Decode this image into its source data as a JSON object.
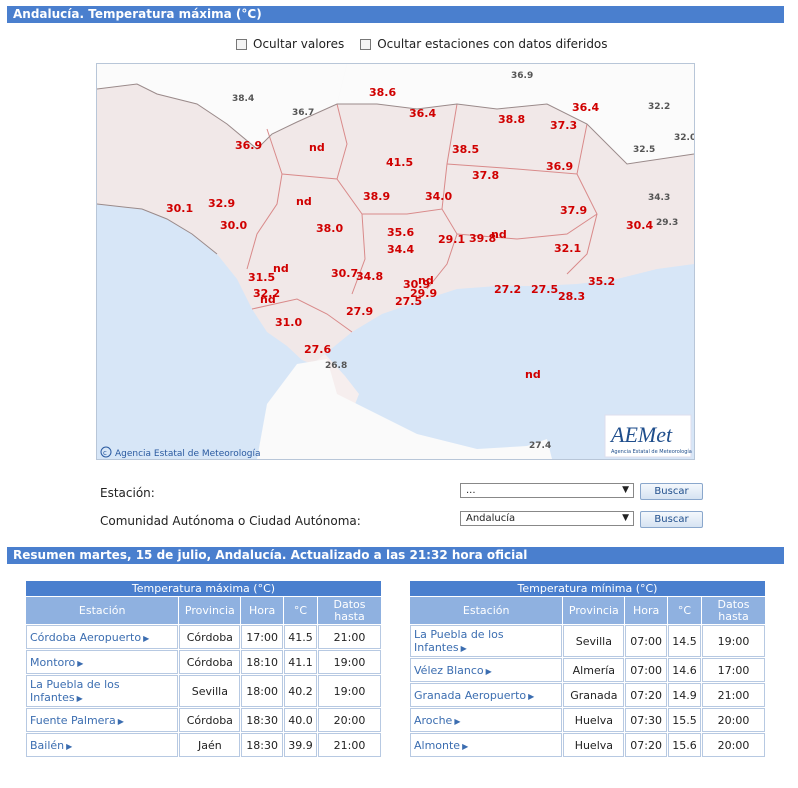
{
  "header": {
    "title": "Andalucía. Temperatura máxima (°C)"
  },
  "options": {
    "hide_values": "Ocultar valores",
    "hide_deferred": "Ocultar estaciones con datos diferidos"
  },
  "map": {
    "copyright": "Agencia Estatal de Meteorología",
    "logo_text": "AEMet",
    "logo_subtext": "Agencia Estatal de Meteorología",
    "values": [
      "38.6",
      "36.4",
      "36.4",
      "38.8",
      "37.3",
      "36.9",
      "nd",
      "41.5",
      "38.5",
      "37.8",
      "36.9",
      "32.9",
      "30.1",
      "nd",
      "38.9",
      "34.0",
      "37.9",
      "30.0",
      "38.0",
      "35.6",
      "nd",
      "29.1",
      "39.8",
      "30.4",
      "34.4",
      "32.1",
      "nd",
      "31.5",
      "30.7",
      "34.8",
      "30.9",
      "nd",
      "35.2",
      "32.2",
      "nd",
      "29.9",
      "27.5",
      "27.2",
      "27.5",
      "28.3",
      "27.9",
      "31.0",
      "27.6",
      "nd"
    ],
    "neighbors": [
      "36.9",
      "38.4",
      "36.7",
      "32.2",
      "32.0",
      "32.5",
      "34.3",
      "29.3",
      "26.8",
      "27.4"
    ]
  },
  "form": {
    "station_label": "Estación:",
    "station_value": "...",
    "community_label": "Comunidad Autónoma o Ciudad Autónoma:",
    "community_value": "Andalucía",
    "search_button": "Buscar"
  },
  "summary": {
    "title": "Resumen martes, 15 de julio, Andalucía. Actualizado a las 21:32 hora oficial"
  },
  "max_table": {
    "caption": "Temperatura máxima (°C)",
    "headers": {
      "station": "Estación",
      "province": "Provincia",
      "hour": "Hora",
      "degrees": "°C",
      "until": "Datos hasta"
    },
    "rows": [
      {
        "station": "Córdoba Aeropuerto",
        "province": "Córdoba",
        "hour": "17:00",
        "value": "41.5",
        "until": "21:00"
      },
      {
        "station": "Montoro",
        "province": "Córdoba",
        "hour": "18:10",
        "value": "41.1",
        "until": "19:00"
      },
      {
        "station": "La Puebla de los Infantes",
        "province": "Sevilla",
        "hour": "18:00",
        "value": "40.2",
        "until": "19:00"
      },
      {
        "station": "Fuente Palmera",
        "province": "Córdoba",
        "hour": "18:30",
        "value": "40.0",
        "until": "20:00"
      },
      {
        "station": "Bailén",
        "province": "Jaén",
        "hour": "18:30",
        "value": "39.9",
        "until": "21:00"
      }
    ]
  },
  "min_table": {
    "caption": "Temperatura mínima (°C)",
    "headers": {
      "station": "Estación",
      "province": "Provincia",
      "hour": "Hora",
      "degrees": "°C",
      "until": "Datos hasta"
    },
    "rows": [
      {
        "station": "La Puebla de los Infantes",
        "province": "Sevilla",
        "hour": "07:00",
        "value": "14.5",
        "until": "19:00"
      },
      {
        "station": "Vélez Blanco",
        "province": "Almería",
        "hour": "07:00",
        "value": "14.6",
        "until": "17:00"
      },
      {
        "station": "Granada Aeropuerto",
        "province": "Granada",
        "hour": "07:20",
        "value": "14.9",
        "until": "21:00"
      },
      {
        "station": "Aroche",
        "province": "Huelva",
        "hour": "07:30",
        "value": "15.5",
        "until": "20:00"
      },
      {
        "station": "Almonte",
        "province": "Huelva",
        "hour": "07:20",
        "value": "15.6",
        "until": "20:00"
      }
    ]
  }
}
